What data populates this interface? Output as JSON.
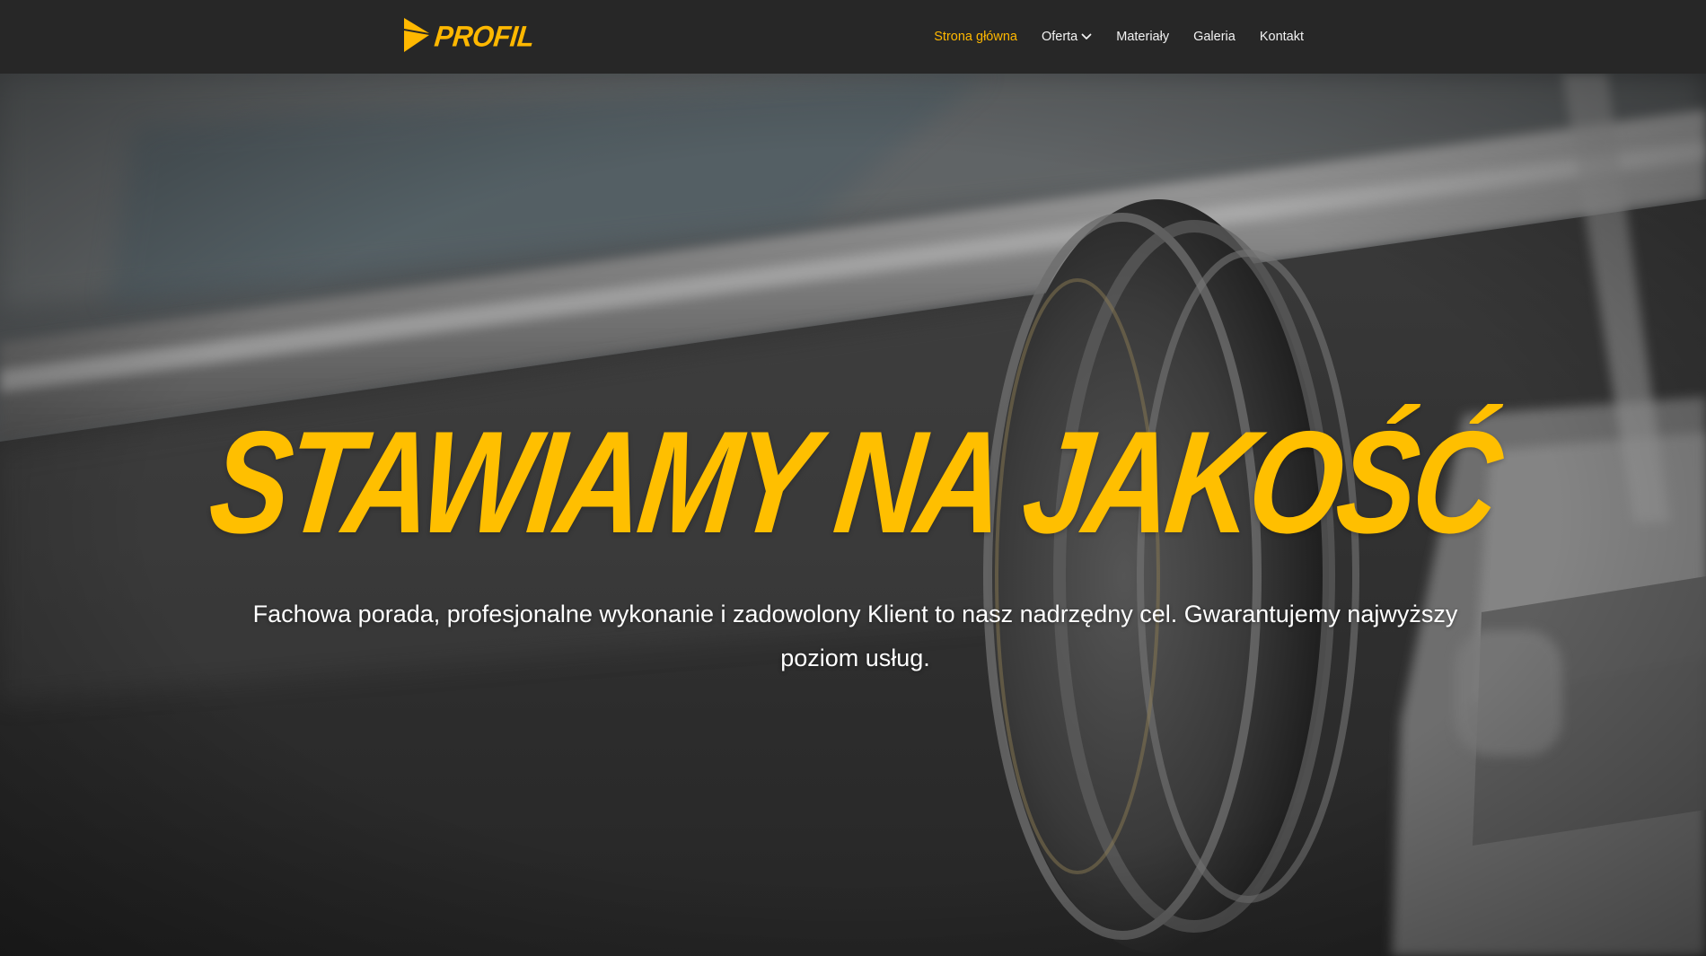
{
  "brand": {
    "logo_text": "PROFIL",
    "accent_color": "#ffb800"
  },
  "nav": {
    "items": [
      {
        "label": "Strona główna",
        "active": true
      },
      {
        "label": "Oferta",
        "has_dropdown": true
      },
      {
        "label": "Materiały"
      },
      {
        "label": "Galeria"
      },
      {
        "label": "Kontakt"
      }
    ]
  },
  "hero": {
    "headline": "STAWIAMY NA JAKOŚĆ",
    "subtitle": "Fachowa porada, profesjonalne wykonanie i zadowolony Klient to nasz nadrzędny cel. Gwarantujemy najwyższy poziom usług."
  },
  "icons": {
    "logo_mark": "yellow-triangle-logo-icon",
    "dropdown": "chevron-down-icon"
  }
}
